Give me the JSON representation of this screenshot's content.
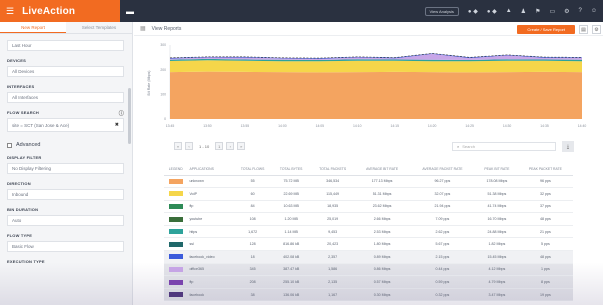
{
  "app": {
    "logo": "LiveAction"
  },
  "topbar": {
    "button_label": "View Analysis",
    "icons": [
      "status-icon",
      "alarm-icon",
      "warning-icon",
      "users-icon",
      "flag-icon",
      "monitor-icon",
      "gear-icon",
      "help-icon",
      "user-icon"
    ]
  },
  "sidebar": {
    "tabs": [
      {
        "label": "New Report"
      },
      {
        "label": "Select Templates"
      }
    ],
    "time_range": "Last Hour",
    "fields": [
      {
        "label": "DEVICES",
        "value": "All Devices"
      },
      {
        "label": "INTERFACES",
        "value": "All Interfaces"
      },
      {
        "label": "FLOW SEARCH",
        "value": "site = SCT (San Jose & Ace)"
      }
    ],
    "advanced_label": "Advanced",
    "advanced_fields": [
      {
        "label": "DISPLAY FILTER",
        "value": "No Display Filtering"
      },
      {
        "label": "DIRECTION",
        "value": "Inbound"
      },
      {
        "label": "BIN DURATION",
        "value": "Auto"
      },
      {
        "label": "FLOW TYPE",
        "value": "Basic Flow"
      },
      {
        "label": "EXECUTION TYPE",
        "value": ""
      }
    ]
  },
  "main": {
    "header_title": "View Reports",
    "save_button": "Create / Save Report",
    "search_placeholder": "Search",
    "pagination": {
      "info": "1 - 10",
      "page": "1"
    }
  },
  "chart_data": {
    "type": "area",
    "ylabel": "Bit Rate (Mbps)",
    "yticks": [
      "300",
      "200",
      "100",
      "0"
    ],
    "xticks": [
      "13:45",
      "13:50",
      "13:55",
      "14:00",
      "14:05",
      "14:10",
      "14:15",
      "14:20",
      "14:25",
      "14:30",
      "14:35",
      "14:40"
    ],
    "ylim": [
      0,
      300
    ],
    "grid": false,
    "series": [
      {
        "color": "#f4a460",
        "values": [
          190,
          192,
          191,
          190,
          189,
          190,
          191,
          190,
          189,
          190,
          191,
          190
        ]
      },
      {
        "color": "#f5d64a",
        "values": [
          45,
          46,
          45,
          44,
          45,
          46,
          45,
          44,
          45,
          46,
          45,
          44
        ]
      },
      {
        "color": "#2ea39b",
        "values": [
          5,
          6,
          5,
          6,
          5,
          6,
          5,
          6,
          5,
          6,
          5,
          6
        ]
      },
      {
        "color": "#c8a6e8",
        "values": [
          5,
          6,
          8,
          6,
          5,
          8,
          5,
          24,
          8,
          16,
          7,
          8
        ]
      },
      {
        "color": "#3b5bdb",
        "values": [
          3,
          2,
          3,
          2,
          3,
          2,
          3,
          2,
          3,
          2,
          3,
          2
        ]
      }
    ]
  },
  "table": {
    "columns": [
      "LEGEND",
      "APPLICATIONS",
      "TOTAL FLOWS",
      "TOTAL BYTES",
      "TOTAL PACKETS",
      "AVERAGE BIT RATE",
      "AVERAGE PACKET RATE",
      "PEAK BIT RATE",
      "PEAK PACKET RATE"
    ],
    "rows": [
      {
        "color": "#f4a460",
        "cells": [
          "unknown",
          "55",
          "75.72 MB",
          "346,534",
          "177.13 Mbps",
          "96.27 pps",
          "178.08 Mbps",
          "96 pps"
        ]
      },
      {
        "color": "#f5d64a",
        "cells": [
          "VoIP",
          "60",
          "22.69 MB",
          "115,449",
          "51.31 Mbps",
          "32.07 pps",
          "51.38 Mbps",
          "32 pps"
        ]
      },
      {
        "color": "#2e8b57",
        "cells": [
          "ftp",
          "84",
          "10.63 MB",
          "18,935",
          "23.62 Mbps",
          "21.94 pps",
          "41.74 Mbps",
          "37 pps"
        ]
      },
      {
        "color": "#3a6e3a",
        "cells": [
          "youtube",
          "108",
          "1.20 MB",
          "25,019",
          "2.66 Mbps",
          "7.09 pps",
          "16.70 Mbps",
          "48 pps"
        ]
      },
      {
        "color": "#2ea39b",
        "cells": [
          "https",
          "1,672",
          "1.14 MB",
          "9,453",
          "2.53 Mbps",
          "2.62 pps",
          "24.88 Mbps",
          "21 pps"
        ]
      },
      {
        "color": "#20686a",
        "cells": [
          "ssl",
          "128",
          "816.86 kB",
          "20,423",
          "1.80 Mbps",
          "5.67 pps",
          "1.82 Mbps",
          "5 pps"
        ]
      },
      {
        "color": "#3b5bdb",
        "cells": [
          "facebook_video",
          "18",
          "402.08 kB",
          "2,357",
          "0.89 Mbps",
          "2.15 pps",
          "15.45 Mbps",
          "48 pps"
        ]
      },
      {
        "color": "#c8a6e8",
        "cells": [
          "office365",
          "345",
          "387.47 kB",
          "1,586",
          "0.86 Mbps",
          "0.44 pps",
          "4.12 Mbps",
          "1 pps"
        ]
      },
      {
        "color": "#7a3fb0",
        "cells": [
          "ftp",
          "208",
          "255.10 kB",
          "2,135",
          "0.57 Mbps",
          "0.59 pps",
          "4.79 Mbps",
          "8 pps"
        ]
      },
      {
        "color": "#4a2f7a",
        "cells": [
          "facebook",
          "38",
          "136.06 kB",
          "1,167",
          "0.30 Mbps",
          "0.32 pps",
          "3.47 Mbps",
          "19 pps"
        ]
      }
    ]
  }
}
